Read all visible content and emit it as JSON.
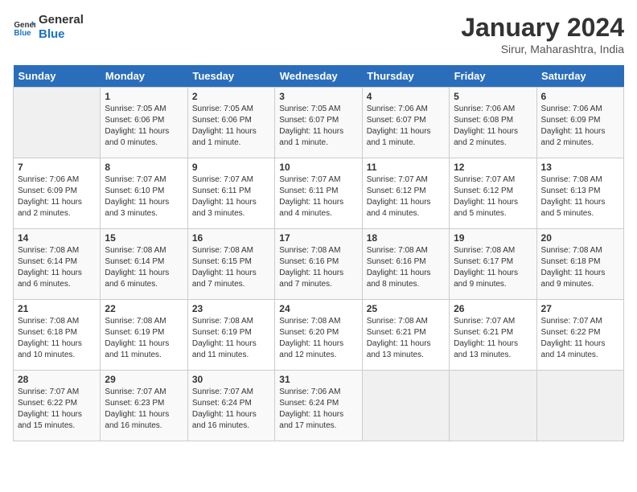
{
  "header": {
    "logo_line1": "General",
    "logo_line2": "Blue",
    "title": "January 2024",
    "subtitle": "Sirur, Maharashtra, India"
  },
  "days_header": [
    "Sunday",
    "Monday",
    "Tuesday",
    "Wednesday",
    "Thursday",
    "Friday",
    "Saturday"
  ],
  "weeks": [
    [
      {
        "day": "",
        "empty": true
      },
      {
        "day": "1",
        "sunrise": "7:05 AM",
        "sunset": "6:06 PM",
        "daylight": "11 hours and 0 minutes."
      },
      {
        "day": "2",
        "sunrise": "7:05 AM",
        "sunset": "6:06 PM",
        "daylight": "11 hours and 1 minute."
      },
      {
        "day": "3",
        "sunrise": "7:05 AM",
        "sunset": "6:07 PM",
        "daylight": "11 hours and 1 minute."
      },
      {
        "day": "4",
        "sunrise": "7:06 AM",
        "sunset": "6:07 PM",
        "daylight": "11 hours and 1 minute."
      },
      {
        "day": "5",
        "sunrise": "7:06 AM",
        "sunset": "6:08 PM",
        "daylight": "11 hours and 2 minutes."
      },
      {
        "day": "6",
        "sunrise": "7:06 AM",
        "sunset": "6:09 PM",
        "daylight": "11 hours and 2 minutes."
      }
    ],
    [
      {
        "day": "7",
        "sunrise": "7:06 AM",
        "sunset": "6:09 PM",
        "daylight": "11 hours and 2 minutes."
      },
      {
        "day": "8",
        "sunrise": "7:07 AM",
        "sunset": "6:10 PM",
        "daylight": "11 hours and 3 minutes."
      },
      {
        "day": "9",
        "sunrise": "7:07 AM",
        "sunset": "6:11 PM",
        "daylight": "11 hours and 3 minutes."
      },
      {
        "day": "10",
        "sunrise": "7:07 AM",
        "sunset": "6:11 PM",
        "daylight": "11 hours and 4 minutes."
      },
      {
        "day": "11",
        "sunrise": "7:07 AM",
        "sunset": "6:12 PM",
        "daylight": "11 hours and 4 minutes."
      },
      {
        "day": "12",
        "sunrise": "7:07 AM",
        "sunset": "6:12 PM",
        "daylight": "11 hours and 5 minutes."
      },
      {
        "day": "13",
        "sunrise": "7:08 AM",
        "sunset": "6:13 PM",
        "daylight": "11 hours and 5 minutes."
      }
    ],
    [
      {
        "day": "14",
        "sunrise": "7:08 AM",
        "sunset": "6:14 PM",
        "daylight": "11 hours and 6 minutes."
      },
      {
        "day": "15",
        "sunrise": "7:08 AM",
        "sunset": "6:14 PM",
        "daylight": "11 hours and 6 minutes."
      },
      {
        "day": "16",
        "sunrise": "7:08 AM",
        "sunset": "6:15 PM",
        "daylight": "11 hours and 7 minutes."
      },
      {
        "day": "17",
        "sunrise": "7:08 AM",
        "sunset": "6:16 PM",
        "daylight": "11 hours and 7 minutes."
      },
      {
        "day": "18",
        "sunrise": "7:08 AM",
        "sunset": "6:16 PM",
        "daylight": "11 hours and 8 minutes."
      },
      {
        "day": "19",
        "sunrise": "7:08 AM",
        "sunset": "6:17 PM",
        "daylight": "11 hours and 9 minutes."
      },
      {
        "day": "20",
        "sunrise": "7:08 AM",
        "sunset": "6:18 PM",
        "daylight": "11 hours and 9 minutes."
      }
    ],
    [
      {
        "day": "21",
        "sunrise": "7:08 AM",
        "sunset": "6:18 PM",
        "daylight": "11 hours and 10 minutes."
      },
      {
        "day": "22",
        "sunrise": "7:08 AM",
        "sunset": "6:19 PM",
        "daylight": "11 hours and 11 minutes."
      },
      {
        "day": "23",
        "sunrise": "7:08 AM",
        "sunset": "6:19 PM",
        "daylight": "11 hours and 11 minutes."
      },
      {
        "day": "24",
        "sunrise": "7:08 AM",
        "sunset": "6:20 PM",
        "daylight": "11 hours and 12 minutes."
      },
      {
        "day": "25",
        "sunrise": "7:08 AM",
        "sunset": "6:21 PM",
        "daylight": "11 hours and 13 minutes."
      },
      {
        "day": "26",
        "sunrise": "7:07 AM",
        "sunset": "6:21 PM",
        "daylight": "11 hours and 13 minutes."
      },
      {
        "day": "27",
        "sunrise": "7:07 AM",
        "sunset": "6:22 PM",
        "daylight": "11 hours and 14 minutes."
      }
    ],
    [
      {
        "day": "28",
        "sunrise": "7:07 AM",
        "sunset": "6:22 PM",
        "daylight": "11 hours and 15 minutes."
      },
      {
        "day": "29",
        "sunrise": "7:07 AM",
        "sunset": "6:23 PM",
        "daylight": "11 hours and 16 minutes."
      },
      {
        "day": "30",
        "sunrise": "7:07 AM",
        "sunset": "6:24 PM",
        "daylight": "11 hours and 16 minutes."
      },
      {
        "day": "31",
        "sunrise": "7:06 AM",
        "sunset": "6:24 PM",
        "daylight": "11 hours and 17 minutes."
      },
      {
        "day": "",
        "empty": true
      },
      {
        "day": "",
        "empty": true
      },
      {
        "day": "",
        "empty": true
      }
    ]
  ],
  "labels": {
    "sunrise": "Sunrise:",
    "sunset": "Sunset:",
    "daylight": "Daylight:"
  }
}
